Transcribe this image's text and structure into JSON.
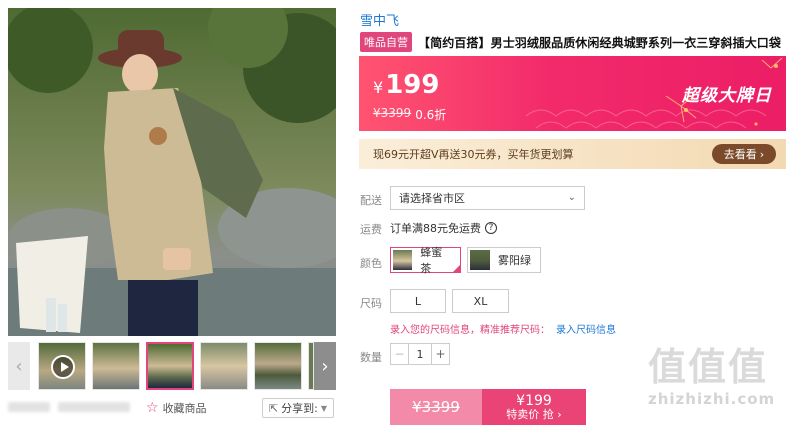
{
  "gallery": {
    "thumb_prev_icon": "chevron-left-icon",
    "thumb_next_icon": "chevron-right-icon",
    "favorite_label": "收藏商品",
    "share_label": "分享到:"
  },
  "product": {
    "brand": "雪中飞",
    "badge": "唯品自营",
    "title": "【简约百搭】男士羽绒服品质休闲经典城野系列一衣三穿斜插大口袋"
  },
  "price": {
    "symbol": "¥",
    "current": "199",
    "original": "¥3399",
    "discount": "0.6折",
    "campaign": "超级大牌日"
  },
  "promo": {
    "text": "现69元开超V再送30元券，买年货更划算",
    "button": "去看看"
  },
  "delivery": {
    "label": "配送",
    "placeholder": "请选择省市区"
  },
  "shipping": {
    "label": "运费",
    "text": "订单满88元免运费"
  },
  "colors": {
    "label": "颜色",
    "options": [
      "蜂蜜茶",
      "雾阳绿"
    ],
    "selected": "蜂蜜茶"
  },
  "sizes": {
    "label": "尺码",
    "options": [
      "L",
      "XL"
    ],
    "note": "录入您的尺码信息，精准推荐尺码：",
    "note_link": "录入尺码信息"
  },
  "quantity": {
    "label": "数量",
    "value": "1"
  },
  "buy": {
    "original": "¥3399",
    "price": "¥199",
    "label": "特卖价 抢"
  },
  "watermark": {
    "big": "值值值",
    "small": "zhizhizhi.com"
  },
  "colors_theme": {
    "accent": "#e0457b",
    "link": "#1e77d4",
    "banner": "#f22a6b"
  }
}
